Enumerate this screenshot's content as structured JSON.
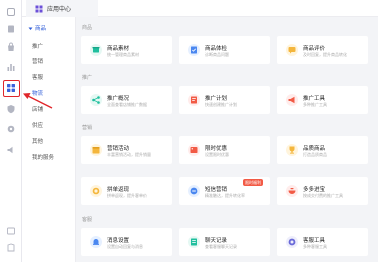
{
  "topbar": {
    "tab_label": "应用中心"
  },
  "rail": {
    "icons": [
      "home-icon",
      "list-icon",
      "bag-icon",
      "chart-icon",
      "grid-apps-icon",
      "shield-icon",
      "settings-icon",
      "speaker-icon",
      "folder-icon",
      "doc-icon"
    ]
  },
  "subnav": {
    "header": "商品",
    "items": [
      "推广",
      "营销",
      "客服",
      "物流",
      "店铺",
      "供应",
      "其他",
      "我的服务"
    ],
    "active_index": 3
  },
  "sections": [
    "商品",
    "推广",
    "营销",
    "",
    "客服"
  ],
  "cards": [
    {
      "title": "商品素材",
      "sub": "统一管理商品素材"
    },
    {
      "title": "商品体检",
      "sub": "诊断商品问题"
    },
    {
      "title": "商品评价",
      "sub": "及时回复，提升商品转化"
    },
    {
      "title": "推广概况",
      "sub": "全面查看店铺推广数据"
    },
    {
      "title": "推广计划",
      "sub": "快速创建推广计划"
    },
    {
      "title": "推广工具",
      "sub": "多种推广工具"
    },
    {
      "title": "营销活动",
      "sub": "丰富营销活动，提升销量"
    },
    {
      "title": "限时优惠",
      "sub": "设置限时优惠"
    },
    {
      "title": "品质商品",
      "sub": "打造品质商品"
    },
    {
      "title": "拼单返现",
      "sub": "拼单返现，提升客单价"
    },
    {
      "title": "短信营销",
      "sub": "精准触达，提升转化率",
      "badge": "限时福利"
    },
    {
      "title": "多多进宝",
      "sub": "按成交付费的推广工具"
    },
    {
      "title": "消息设置",
      "sub": "设置自动回复与消息"
    },
    {
      "title": "聊天记录",
      "sub": "查看客服聊天记录"
    },
    {
      "title": "客服工具",
      "sub": "多种客服工具"
    }
  ],
  "colors": {
    "accent": "#2d5bd8",
    "annotation_red": "#e0262b",
    "icon_red": "#f25a45",
    "icon_teal": "#1fbf9e",
    "icon_yellow": "#f4b63c",
    "icon_purple": "#6a6ad8",
    "icon_blue": "#4a87f0"
  }
}
